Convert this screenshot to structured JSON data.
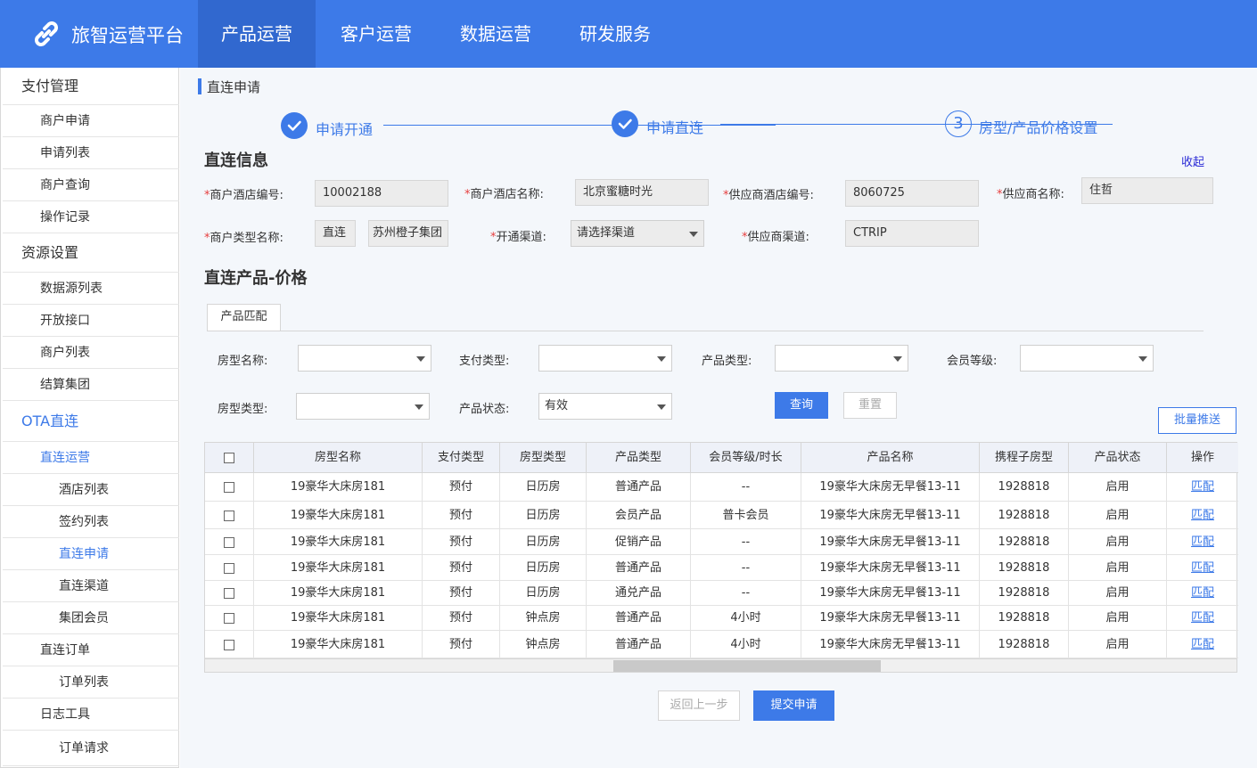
{
  "brand": "旅智运营平台",
  "nav": [
    "产品运营",
    "客户运营",
    "数据运营",
    "研发服务"
  ],
  "sidebar": [
    {
      "label": "支付管理",
      "level": 1
    },
    {
      "label": "商户申请",
      "level": 2
    },
    {
      "label": "申请列表",
      "level": 2
    },
    {
      "label": "商户查询",
      "level": 2
    },
    {
      "label": "操作记录",
      "level": 2
    },
    {
      "label": "资源设置",
      "level": 1
    },
    {
      "label": "数据源列表",
      "level": 2
    },
    {
      "label": "开放接口",
      "level": 2
    },
    {
      "label": "商户列表",
      "level": 2
    },
    {
      "label": "结算集团",
      "level": 2
    },
    {
      "label": "OTA直连",
      "level": 1
    },
    {
      "label": "直连运营",
      "level": 2
    },
    {
      "label": "酒店列表",
      "level": 3
    },
    {
      "label": "签约列表",
      "level": 3
    },
    {
      "label": "直连申请",
      "level": 3
    },
    {
      "label": "直连渠道",
      "level": 3
    },
    {
      "label": "集团会员",
      "level": 3
    },
    {
      "label": "直连订单",
      "level": 2
    },
    {
      "label": "订单列表",
      "level": 3
    },
    {
      "label": "日志工具",
      "level": 2
    },
    {
      "label": "订单请求",
      "level": 3
    }
  ],
  "breadcrumb": "直连申请",
  "steps": [
    {
      "label": "申请开通",
      "status": "done"
    },
    {
      "label": "申请直连",
      "status": "done"
    },
    {
      "label": "房型/产品价格设置",
      "number": "3",
      "status": "current"
    }
  ],
  "info": {
    "title": "直连信息",
    "collapse": "收起",
    "hotel_code_label": "商户酒店编号:",
    "hotel_code": "10002188",
    "hotel_name_label": "商户酒店名称:",
    "hotel_name": "北京蜜糖时光",
    "supplier_hotel_code_label": "供应商酒店编号:",
    "supplier_hotel_code": "8060725",
    "supplier_name_label": "供应商名称:",
    "supplier_name": "住哲",
    "merchant_type_label": "商户类型名称:",
    "merchant_type": "直连",
    "merchant_group": "苏州橙子集团",
    "channel_label": "开通渠道:",
    "channel_value": "请选择渠道",
    "supplier_channel_label": "供应商渠道:",
    "supplier_channel": "CTRIP"
  },
  "product": {
    "title": "直连产品-价格",
    "tab": "产品匹配",
    "room_name_label": "房型名称:",
    "pay_type_label": "支付类型:",
    "product_type_label": "产品类型:",
    "member_level_label": "会员等级:",
    "room_type_label": "房型类型:",
    "product_status_label": "产品状态:",
    "product_status_value": "有效",
    "query": "查询",
    "reset": "重置",
    "batch_push": "批量推送"
  },
  "table": {
    "headers": [
      "房型名称",
      "支付类型",
      "房型类型",
      "产品类型",
      "会员等级/时长",
      "产品名称",
      "携程子房型",
      "产品状态",
      "操作"
    ],
    "rows": [
      [
        "19豪华大床房181",
        "预付",
        "日历房",
        "普通产品",
        "--",
        "19豪华大床房无早餐13-11",
        "1928818",
        "启用",
        "匹配"
      ],
      [
        "19豪华大床房181",
        "预付",
        "日历房",
        "会员产品",
        "普卡会员",
        "19豪华大床房无早餐13-11",
        "1928818",
        "启用",
        "匹配"
      ],
      [
        "19豪华大床房181",
        "预付",
        "日历房",
        "促销产品",
        "--",
        "19豪华大床房无早餐13-11",
        "1928818",
        "启用",
        "匹配"
      ],
      [
        "19豪华大床房181",
        "预付",
        "日历房",
        "普通产品",
        "--",
        "19豪华大床房无早餐13-11",
        "1928818",
        "启用",
        "匹配"
      ],
      [
        "19豪华大床房181",
        "预付",
        "日历房",
        "通兑产品",
        "--",
        "19豪华大床房无早餐13-11",
        "1928818",
        "启用",
        "匹配"
      ],
      [
        "19豪华大床房181",
        "预付",
        "钟点房",
        "普通产品",
        "4小时",
        "19豪华大床房无早餐13-11",
        "1928818",
        "启用",
        "匹配"
      ],
      [
        "19豪华大床房181",
        "预付",
        "钟点房",
        "普通产品",
        "4小时",
        "19豪华大床房无早餐13-11",
        "1928818",
        "启用",
        "匹配"
      ]
    ]
  },
  "footer": {
    "back": "返回上一步",
    "submit": "提交申请"
  }
}
